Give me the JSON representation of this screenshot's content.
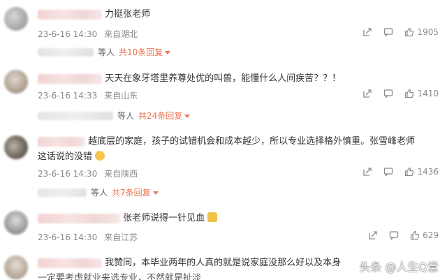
{
  "comments": [
    {
      "text": "力挺张老师",
      "time": "23-6-16 14:30",
      "location": "来自湖北",
      "likes": "1905",
      "reply_suffix": "等人",
      "reply_link": "共10条回复"
    },
    {
      "text": "天天在象牙塔里养尊处优的叫兽，能懂什么人间疾苦？？！",
      "time": "23-6-16 14:33",
      "location": "来自山东",
      "likes": "1410",
      "reply_suffix": "等人",
      "reply_link": "共24条回复"
    },
    {
      "text_line1": "越底层的家庭，孩子的试错机会和成本越少，所以专业选择格外慎重。张雪峰老师",
      "text_line2": "这话说的没错",
      "time": "23-6-16 14:30",
      "location": "来自陕西",
      "likes": "1436",
      "reply_suffix": "等人",
      "reply_link": "共7条回复"
    },
    {
      "text": "张老师说得一针见血",
      "time": "23-6-16 14:30",
      "location": "来自江苏",
      "likes": "629"
    },
    {
      "text_line1": "我赞同，本毕业两年的人真的就是说家庭没那么好以及本身",
      "text_line2": "一定要考虑就业来选专业，不然就是扯淡"
    }
  ],
  "watermark": "头条 @人生Q意",
  "icons": {
    "share": "share-icon",
    "comment": "comment-icon",
    "like": "thumbs-up-icon"
  }
}
